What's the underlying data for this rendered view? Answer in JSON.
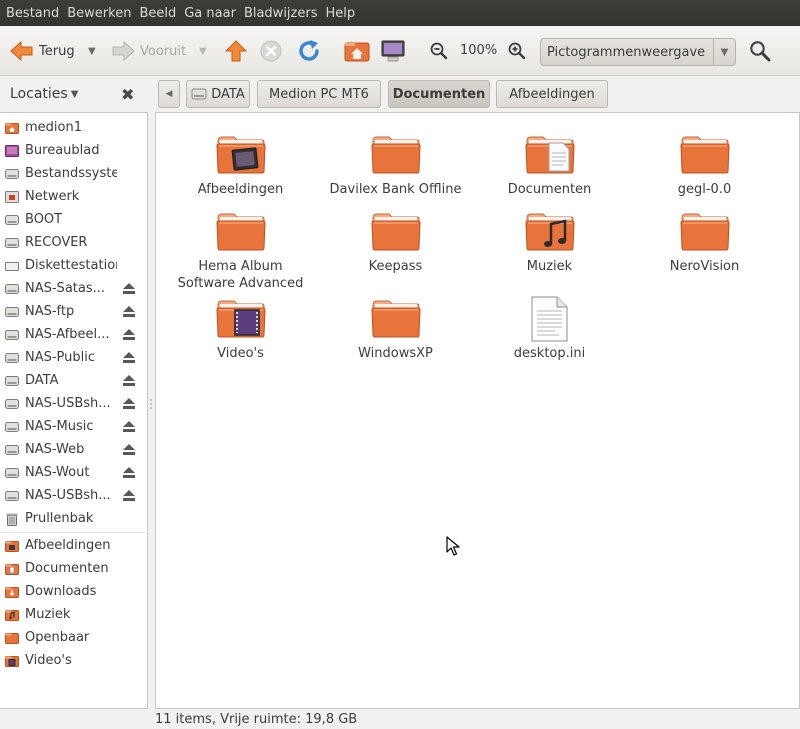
{
  "menubar": {
    "items": [
      "Bestand",
      "Bewerken",
      "Beeld",
      "Ga naar",
      "Bladwijzers",
      "Help"
    ]
  },
  "toolbar": {
    "back_label": "Terug",
    "forward_label": "Vooruit",
    "zoom_level": "100%",
    "view_mode": "Pictogrammenweergave"
  },
  "sidebar": {
    "header": "Locaties",
    "devices": [
      {
        "label": "medion1",
        "icon": "home-icon"
      },
      {
        "label": "Bureaublad",
        "icon": "desktop-icon"
      },
      {
        "label": "Bestandssysteem",
        "icon": "harddisk-icon"
      },
      {
        "label": "Netwerk",
        "icon": "network-icon"
      },
      {
        "label": "BOOT",
        "icon": "harddisk-icon"
      },
      {
        "label": "RECOVER",
        "icon": "harddisk-icon"
      },
      {
        "label": "Diskettestation",
        "icon": "floppy-icon"
      },
      {
        "label": "NAS-Satas...",
        "icon": "harddisk-icon",
        "eject": true
      },
      {
        "label": "NAS-ftp",
        "icon": "harddisk-icon",
        "eject": true
      },
      {
        "label": "NAS-Afbeel...",
        "icon": "harddisk-icon",
        "eject": true
      },
      {
        "label": "NAS-Public",
        "icon": "harddisk-icon",
        "eject": true
      },
      {
        "label": "DATA",
        "icon": "harddisk-icon",
        "eject": true
      },
      {
        "label": "NAS-USBsh...",
        "icon": "harddisk-icon",
        "eject": true
      },
      {
        "label": "NAS-Music",
        "icon": "harddisk-icon",
        "eject": true
      },
      {
        "label": "NAS-Web",
        "icon": "harddisk-icon",
        "eject": true
      },
      {
        "label": "NAS-Wout",
        "icon": "harddisk-icon",
        "eject": true
      },
      {
        "label": "NAS-USBsh...",
        "icon": "harddisk-icon",
        "eject": true
      },
      {
        "label": "Prullenbak",
        "icon": "trash-icon"
      }
    ],
    "bookmarks": [
      {
        "label": "Afbeeldingen",
        "icon": "pictures-folder-icon"
      },
      {
        "label": "Documenten",
        "icon": "documents-folder-icon"
      },
      {
        "label": "Downloads",
        "icon": "downloads-folder-icon"
      },
      {
        "label": "Muziek",
        "icon": "music-folder-icon"
      },
      {
        "label": "Openbaar",
        "icon": "public-folder-icon"
      },
      {
        "label": "Video's",
        "icon": "videos-folder-icon"
      }
    ]
  },
  "breadcrumb": {
    "items": [
      "DATA",
      "Medion PC MT6",
      "Documenten",
      "Afbeeldingen"
    ],
    "active_index": 2
  },
  "files": [
    {
      "name": "Afbeeldingen",
      "type": "folder",
      "emblem": "pictures"
    },
    {
      "name": "Davilex Bank Offline",
      "type": "folder"
    },
    {
      "name": "Documenten",
      "type": "folder",
      "emblem": "document"
    },
    {
      "name": "gegl-0.0",
      "type": "folder"
    },
    {
      "name": "Hema Album Software Advanced",
      "type": "folder"
    },
    {
      "name": "Keepass",
      "type": "folder"
    },
    {
      "name": "Muziek",
      "type": "folder",
      "emblem": "music"
    },
    {
      "name": "NeroVision",
      "type": "folder"
    },
    {
      "name": "Video's",
      "type": "folder",
      "emblem": "video"
    },
    {
      "name": "WindowsXP",
      "type": "folder"
    },
    {
      "name": "desktop.ini",
      "type": "text-file"
    }
  ],
  "statusbar": {
    "text": "11 items, Vrije ruimte: 19,8 GB"
  },
  "colors": {
    "menubar_bg": "#3c3b37",
    "folder_orange": "#e8743b",
    "folder_top": "#f3ab82"
  }
}
